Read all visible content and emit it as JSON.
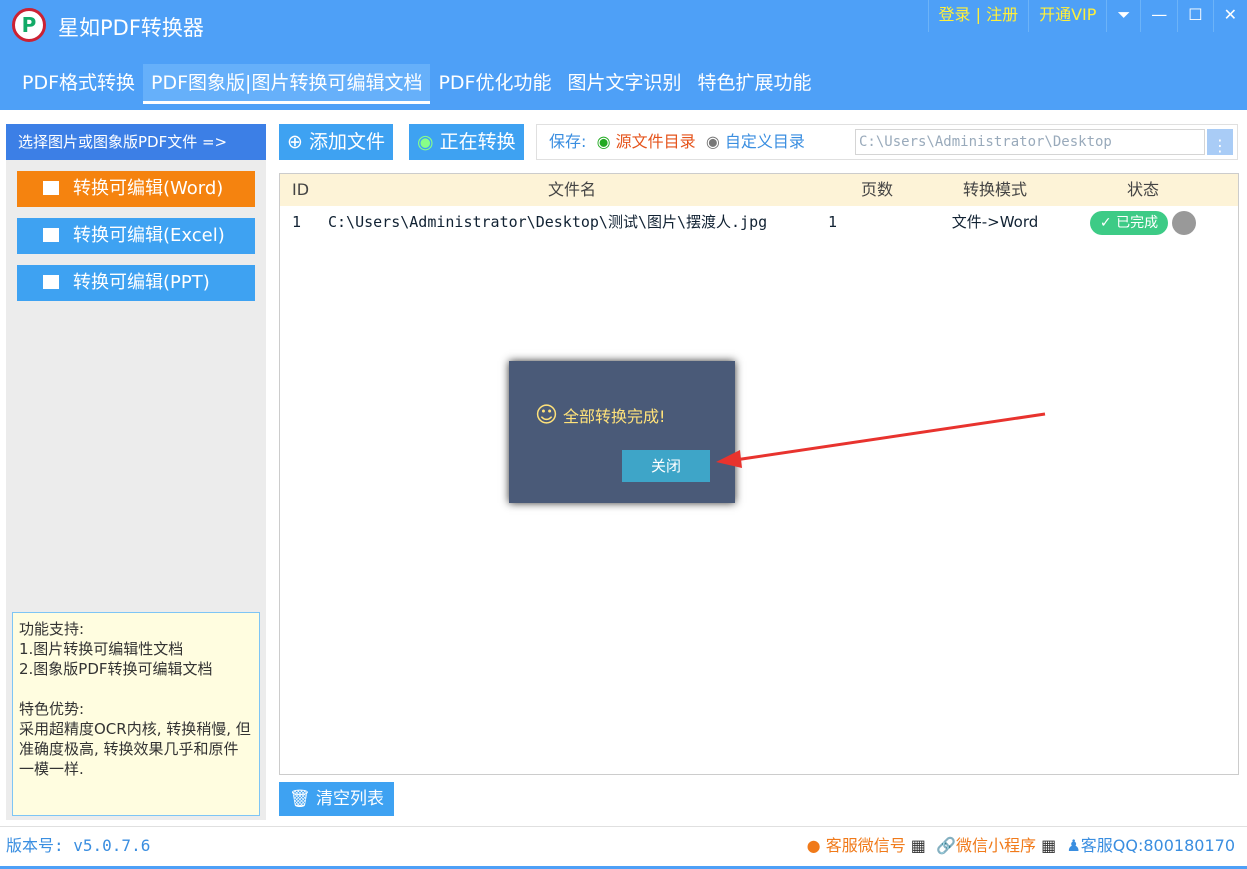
{
  "app": {
    "title": "星如PDF转换器",
    "login": "登录 | 注册",
    "vip": "开通VIP"
  },
  "tabs": [
    "PDF格式转换",
    "PDF图象版|图片转换可编辑文档",
    "PDF优化功能",
    "图片文字识别",
    "特色扩展功能"
  ],
  "left": {
    "header": "选择图片或图象版PDF文件 =>",
    "buttons": [
      "转换可编辑(Word)",
      "转换可编辑(Excel)",
      "转换可编辑(PPT)"
    ],
    "info": "功能支持:\n1.图片转换可编辑性文档\n2.图象版PDF转换可编辑文档\n\n特色优势:\n采用超精度OCR内核, 转换稍慢, 但准确度极高, 转换效果几乎和原件一模一样."
  },
  "toolbar": {
    "add": "添加文件",
    "converting": "正在转换",
    "save_label": "保存:",
    "opt_source": "源文件目录",
    "opt_custom": "自定义目录",
    "path": "C:\\Users\\Administrator\\Desktop"
  },
  "table": {
    "headers": [
      "ID",
      "文件名",
      "页数",
      "转换模式",
      "状态"
    ],
    "rows": [
      {
        "id": "1",
        "file": "C:\\Users\\Administrator\\Desktop\\测试\\图片\\摆渡人.jpg",
        "pages": "1",
        "mode": "文件->Word",
        "status": "已完成"
      }
    ]
  },
  "clear": "清空列表",
  "dialog": {
    "message": "全部转换完成!",
    "close": "关闭"
  },
  "footer": {
    "version": "版本号: v5.0.7.6",
    "wechat": "客服微信号",
    "miniapp": "微信小程序",
    "qq_label": "客服QQ:",
    "qq": "800180170"
  }
}
